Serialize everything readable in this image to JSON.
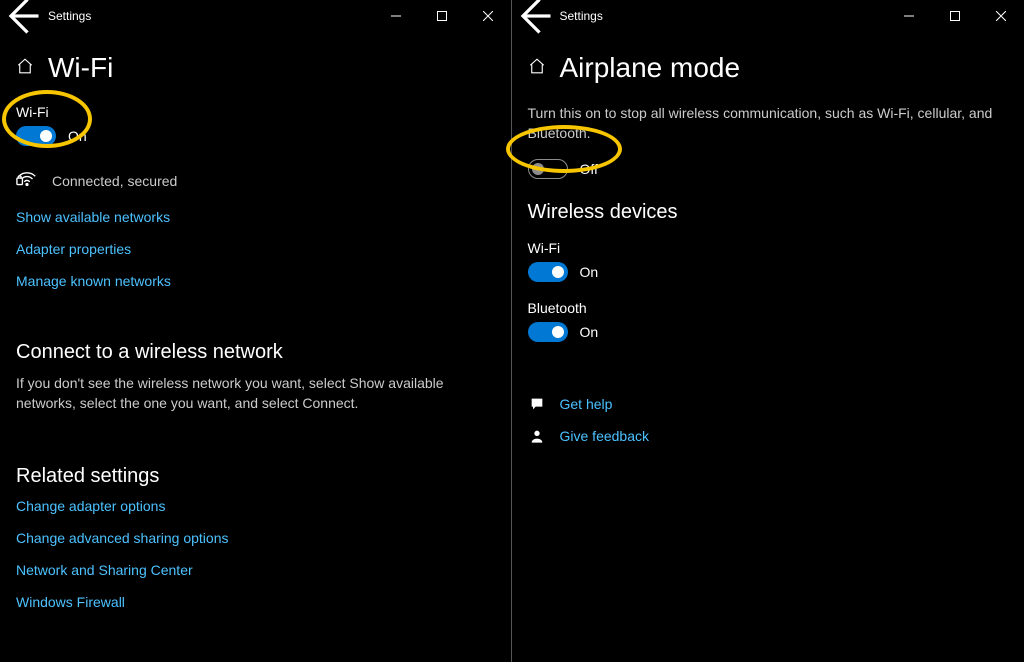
{
  "left": {
    "titlebar": {
      "title": "Settings"
    },
    "page_title": "Wi-Fi",
    "wifi": {
      "label": "Wi-Fi",
      "state_text": "On"
    },
    "status": "Connected, secured",
    "links": {
      "show_networks": "Show available networks",
      "adapter_props": "Adapter properties",
      "manage_known": "Manage known networks"
    },
    "connect": {
      "heading": "Connect to a wireless network",
      "body": "If you don't see the wireless network you want, select Show available networks, select the one you want, and select Connect."
    },
    "related": {
      "heading": "Related settings",
      "change_adapter": "Change adapter options",
      "change_sharing": "Change advanced sharing options",
      "nsc": "Network and Sharing Center",
      "firewall": "Windows Firewall"
    }
  },
  "right": {
    "titlebar": {
      "title": "Settings"
    },
    "page_title": "Airplane mode",
    "desc": "Turn this on to stop all wireless communication, such as Wi-Fi, cellular, and Bluetooth.",
    "airplane": {
      "state_text": "Off"
    },
    "wireless_heading": "Wireless devices",
    "wifi": {
      "label": "Wi-Fi",
      "state_text": "On"
    },
    "bluetooth": {
      "label": "Bluetooth",
      "state_text": "On"
    },
    "help": {
      "get_help": "Get help",
      "give_feedback": "Give feedback"
    }
  }
}
